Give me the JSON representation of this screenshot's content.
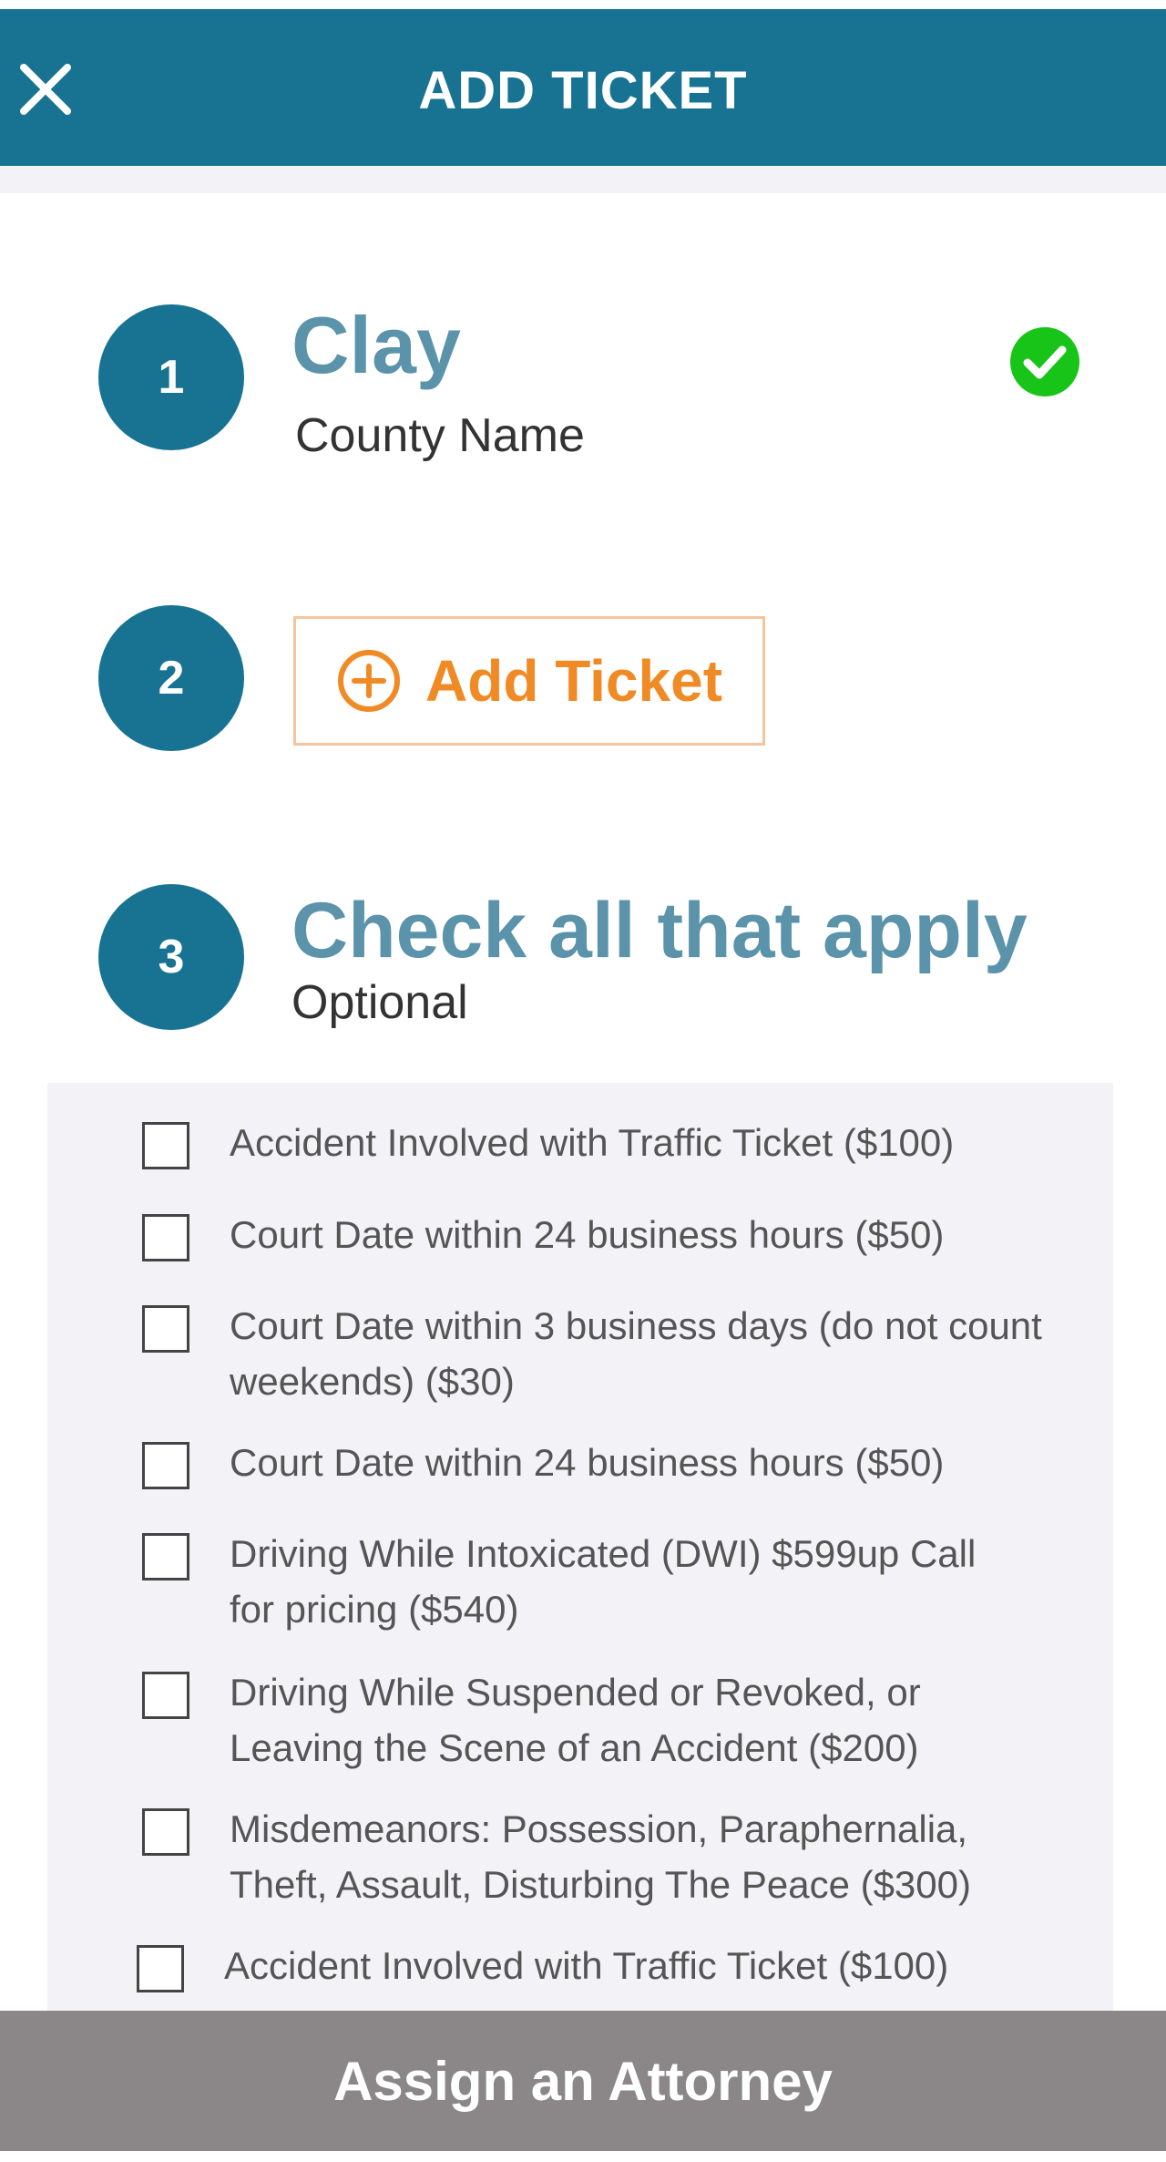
{
  "header": {
    "title": "ADD TICKET"
  },
  "step1": {
    "number": "1",
    "value": "Clay",
    "label": "County Name"
  },
  "step2": {
    "number": "2",
    "button_label": "Add Ticket"
  },
  "step3": {
    "number": "3",
    "title": "Check all that apply",
    "subtitle": "Optional",
    "options": [
      {
        "label": "Accident Involved with Traffic Ticket ($100)"
      },
      {
        "label": "Court Date within 24 business hours ($50)"
      },
      {
        "label": "Court Date within 3 business days (do not count weekends) ($30)"
      },
      {
        "label": "Court Date within 24 business hours ($50)"
      },
      {
        "label": "Driving While Intoxicated (DWI) $599up Call for pricing ($540)"
      },
      {
        "label": "Driving While Suspended or Revoked, or Leaving the Scene of an Accident ($200)"
      },
      {
        "label": "Misdemeanors: Possession, Paraphernalia, Theft, Assault, Disturbing The Peace ($300)"
      },
      {
        "label": "Accident Involved with Traffic Ticket ($100)"
      }
    ]
  },
  "footer": {
    "assign_label": "Assign an Attorney"
  },
  "colors": {
    "header": "#177391",
    "step_circle": "#177391",
    "accent_text": "#5b93aa",
    "add_ticket": "#f08a24",
    "success": "#17c417",
    "assign_button": "#8b8789"
  }
}
